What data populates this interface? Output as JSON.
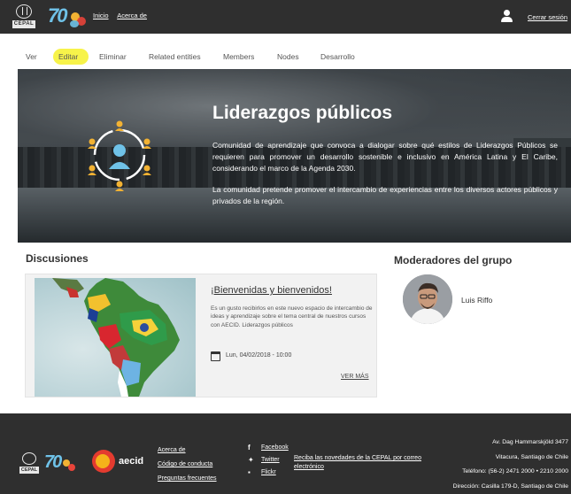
{
  "header": {
    "nav": [
      "Inicio",
      "Acerca de"
    ],
    "logout_label": "Cerrar sesión",
    "un_label": "CEPAL",
    "anniversary_label": "70"
  },
  "tabs": [
    "Ver",
    "Editar",
    "Eliminar",
    "Related entities",
    "Members",
    "Nodes",
    "Desarrollo"
  ],
  "hero": {
    "title": "Liderazgos públicos",
    "paragraph1": "Comunidad de aprendizaje que convoca a dialogar sobre qué estilos de Liderazgos Públicos se requieren para promover un desarrollo sostenible e inclusivo en América Latina y El Caribe, considerando el marco de la Agenda 2030.",
    "paragraph2": "La comunidad pretende promover el intercambio de experiencias entre los diversos actores públicos y privados de la región."
  },
  "discussions": {
    "heading": "Discusiones",
    "card": {
      "title": "¡Bienvenidas y bienvenidos!",
      "text": "Es un gusto recibirlos en este nuevo espacio de intercambio de ideas y aprendizaje sobre el tema central de nuestros cursos con AECID. Liderazgos públicos",
      "date": "Lun, 04/02/2018 - 10:00",
      "more": "VER MÁS"
    }
  },
  "moderators": {
    "heading": "Moderadores del grupo",
    "items": [
      {
        "name": "Luis Riffo"
      }
    ]
  },
  "footer": {
    "un_label": "CEPAL",
    "aecid": "aecid",
    "links": [
      "Acerca de",
      "Código de conducta",
      "Preguntas frecuentes"
    ],
    "social": [
      "Facebook",
      "Twitter",
      "Flickr"
    ],
    "newsletter": "Reciba las novedades de la CEPAL por correo electrónico",
    "address": [
      "Av. Dag Hammarskjöld 3477",
      "Vitacura, Santiago de Chile",
      "Teléfono: (56-2) 2471 2000 • 2210 2000",
      "Dirección: Casilla 179-D, Santiago de Chile"
    ]
  },
  "colors": {
    "topbar": "#2f2f2f",
    "highlight": "#f7f34a",
    "accent_blue": "#6fc2e8",
    "accent_orange": "#f2b233"
  }
}
